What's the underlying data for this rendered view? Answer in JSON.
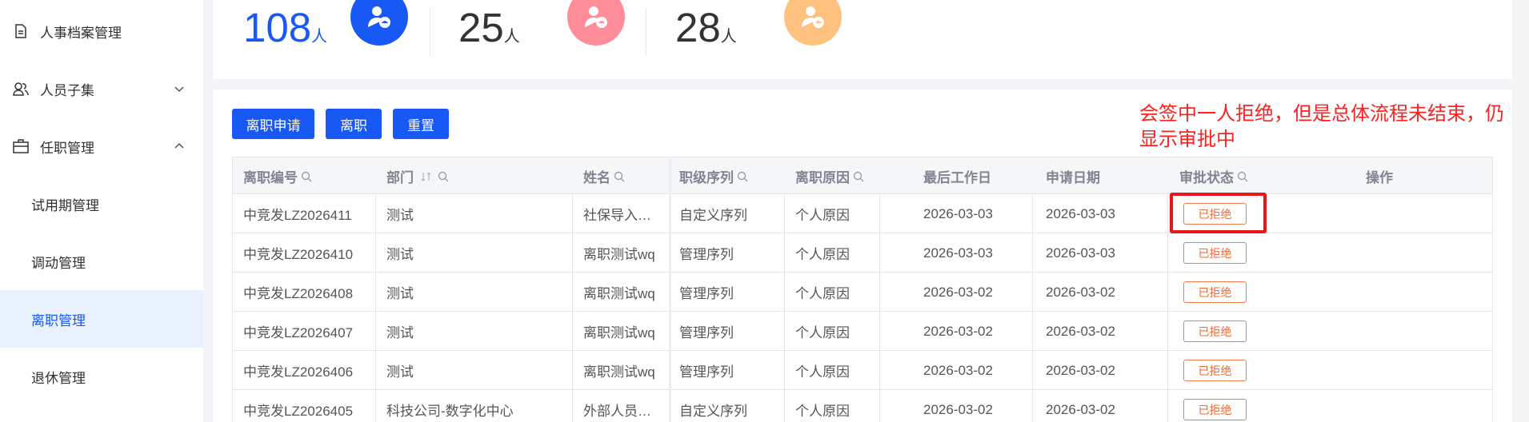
{
  "sidebar": {
    "items": [
      {
        "label": "人事档案管理"
      },
      {
        "label": "人员子集"
      },
      {
        "label": "任职管理"
      }
    ],
    "sub_items": [
      {
        "label": "试用期管理"
      },
      {
        "label": "调动管理"
      },
      {
        "label": "离职管理"
      },
      {
        "label": "退休管理"
      }
    ]
  },
  "stats": [
    {
      "value": "108",
      "unit": "人",
      "color": "#1858f5"
    },
    {
      "value": "25",
      "unit": "人",
      "color": "#ff8c99"
    },
    {
      "value": "28",
      "unit": "人",
      "color": "#fec27e"
    }
  ],
  "toolbar": {
    "apply_label": "离职申请",
    "resign_label": "离职",
    "reset_label": "重置"
  },
  "annotation": "会签中一人拒绝，但是总体流程未结束，仍显示审批中",
  "table": {
    "headers": [
      "离职编号",
      "部门",
      "姓名",
      "职级序列",
      "离职原因",
      "最后工作日",
      "申请日期",
      "审批状态",
      "操作"
    ],
    "rows": [
      {
        "id": "中竞发LZ2026411",
        "dept": "测试",
        "name": "社保导入…",
        "rank": "自定义序列",
        "reason": "个人原因",
        "last_day": "2026-03-03",
        "apply_date": "2026-03-03",
        "status": "已拒绝"
      },
      {
        "id": "中竞发LZ2026410",
        "dept": "测试",
        "name": "离职测试wq",
        "rank": "管理序列",
        "reason": "个人原因",
        "last_day": "2026-03-03",
        "apply_date": "2026-03-03",
        "status": "已拒绝"
      },
      {
        "id": "中竞发LZ2026408",
        "dept": "测试",
        "name": "离职测试wq",
        "rank": "管理序列",
        "reason": "个人原因",
        "last_day": "2026-03-02",
        "apply_date": "2026-03-02",
        "status": "已拒绝"
      },
      {
        "id": "中竞发LZ2026407",
        "dept": "测试",
        "name": "离职测试wq",
        "rank": "管理序列",
        "reason": "个人原因",
        "last_day": "2026-03-02",
        "apply_date": "2026-03-02",
        "status": "已拒绝"
      },
      {
        "id": "中竞发LZ2026406",
        "dept": "测试",
        "name": "离职测试wq",
        "rank": "管理序列",
        "reason": "个人原因",
        "last_day": "2026-03-02",
        "apply_date": "2026-03-02",
        "status": "已拒绝"
      },
      {
        "id": "中竞发LZ2026405",
        "dept": "科技公司-数字化中心",
        "name": "外部人员…",
        "rank": "自定义序列",
        "reason": "个人原因",
        "last_day": "2026-03-02",
        "apply_date": "2026-03-02",
        "status": "已拒绝"
      }
    ]
  },
  "colors": {
    "primary": "#1858f5",
    "rejected": "#f06a35",
    "annotation": "#ff2020"
  }
}
